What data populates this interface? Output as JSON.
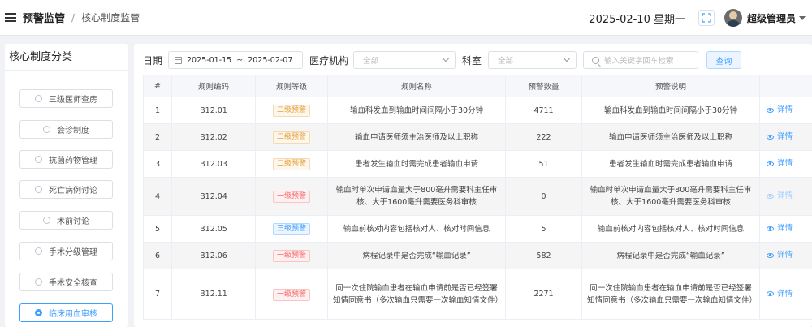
{
  "header": {
    "breadcrumb_root": "预警监管",
    "breadcrumb_sep": "/",
    "breadcrumb_current": "核心制度监管",
    "datetime": "2025-02-10 星期一",
    "username": "超级管理员"
  },
  "sidebar": {
    "title": "核心制度分类",
    "items": [
      {
        "label": "三级医师查房"
      },
      {
        "label": "会诊制度"
      },
      {
        "label": "抗菌药物管理"
      },
      {
        "label": "死亡病例讨论"
      },
      {
        "label": "术前讨论"
      },
      {
        "label": "手术分级管理"
      },
      {
        "label": "手术安全核查"
      },
      {
        "label": "临床用血审核",
        "active": true
      }
    ]
  },
  "filters": {
    "date_label": "日期",
    "date_start": "2025-01-15",
    "date_sep": "~",
    "date_end": "2025-02-07",
    "org_label": "医疗机构",
    "org_placeholder": "全部",
    "dept_label": "科室",
    "dept_placeholder": "全部",
    "search_placeholder": "输入关键字回车检索",
    "query_label": "查询"
  },
  "table": {
    "columns": [
      "#",
      "规则编码",
      "规则等级",
      "规则名称",
      "预警数量",
      "预警说明",
      ""
    ],
    "detail_label": "详情",
    "rows": [
      {
        "no": "1",
        "code": "B12.01",
        "level": "二级预警",
        "level_type": "l2",
        "name": "输血科发血到输血时间间隔小于30分钟",
        "count": "4711",
        "desc": "输血科发血到输血时间间隔小于30分钟",
        "detail_enabled": true
      },
      {
        "no": "2",
        "code": "B12.02",
        "level": "二级预警",
        "level_type": "l2",
        "name": "输血申请医师须主治医师及以上职称",
        "count": "222",
        "desc": "输血申请医师须主治医师及以上职称",
        "detail_enabled": true
      },
      {
        "no": "3",
        "code": "B12.03",
        "level": "二级预警",
        "level_type": "l2",
        "name": "患者发生输血时需完成患者输血申请",
        "count": "51",
        "desc": "患者发生输血时需完成患者输血申请",
        "detail_enabled": true
      },
      {
        "no": "4",
        "code": "B12.04",
        "level": "一级预警",
        "level_type": "l1",
        "name": "输血时单次申请血量大于800毫升需要科主任审核、大于1600毫升需要医务科审核",
        "count": "0",
        "desc": "输血时单次申请血量大于800毫升需要科主任审核、大于1600毫升需要医务科审核",
        "detail_enabled": false
      },
      {
        "no": "5",
        "code": "B12.05",
        "level": "三级预警",
        "level_type": "l3",
        "name": "输血前核对内容包括核对人、核对时间信息",
        "count": "5",
        "desc": "输血前核对内容包括核对人、核对时间信息",
        "detail_enabled": true
      },
      {
        "no": "6",
        "code": "B12.06",
        "level": "一级预警",
        "level_type": "l1",
        "name": "病程记录中是否完成“输血记录”",
        "count": "582",
        "desc": "病程记录中是否完成“输血记录”",
        "detail_enabled": true
      },
      {
        "no": "7",
        "code": "B12.11",
        "level": "一级预警",
        "level_type": "l1",
        "name": "同一次住院输血患者在输血申请前是否已经签署知情同意书（多次输血只需要一次输血知情文件）",
        "count": "2271",
        "desc": "同一次住院输血患者在输血申请前是否已经签署知情同意书（多次输血只需要一次输血知情文件）",
        "detail_enabled": true
      }
    ]
  },
  "colors": {
    "accent": "#409eff",
    "level1": "#f56c6c",
    "level2": "#e6a23c",
    "level3": "#409eff"
  }
}
